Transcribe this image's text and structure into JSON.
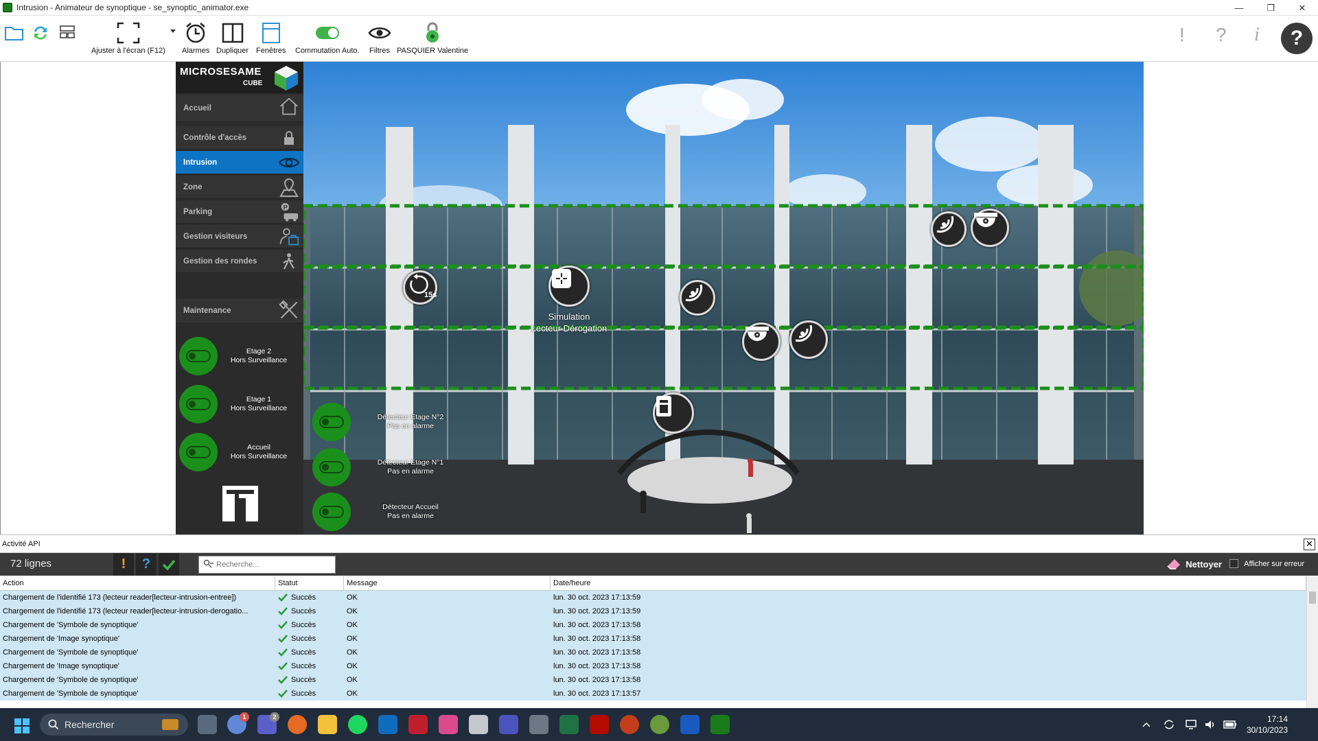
{
  "window": {
    "title": "Intrusion - Animateur de synoptique - se_synoptic_animator.exe",
    "controls": [
      "—",
      "❐",
      "✕"
    ]
  },
  "toolbar": {
    "fit_label": "Ajuster à l'écran (F12)",
    "alarms_label": "Alarmes",
    "duplicate_label": "Dupliquer",
    "windows_label": "Fenêtres",
    "auto_switch_label": "Commutation Auto.",
    "filters_label": "Filtres",
    "user_label": "PASQUIER Valentine",
    "right_icons": [
      "!",
      "?",
      "i"
    ]
  },
  "sidebar": {
    "logo_text": "MICROSESAME",
    "logo_sub": "CUBE",
    "items": [
      {
        "label": "Accueil"
      },
      {
        "label": "Contrôle d'accès"
      },
      {
        "label": "Intrusion"
      },
      {
        "label": "Zone"
      },
      {
        "label": "Parking"
      },
      {
        "label": "Gestion visiteurs"
      },
      {
        "label": "Gestion des rondes"
      },
      {
        "label": "Maintenance"
      }
    ],
    "floors": [
      {
        "name": "Etage 2",
        "state": "Hors Surveillance"
      },
      {
        "name": "Etage 1",
        "state": "Hors Surveillance"
      },
      {
        "name": "Accueil",
        "state": "Hors Surveillance"
      }
    ]
  },
  "scene": {
    "timer_label": "15s",
    "simulation_line1": "Simulation",
    "simulation_line2": "Lecteur Dérogation",
    "detectors": [
      {
        "name": "Détecteur Etage N°2",
        "state": "Pas en alarme"
      },
      {
        "name": "Détecteur Etage N°1",
        "state": "Pas en alarme"
      },
      {
        "name": "Détecteur Accueil",
        "state": "Pas en alarme"
      }
    ]
  },
  "api": {
    "title": "Activité API",
    "close": "✕",
    "count": "72 lignes",
    "filter_warning": "!",
    "filter_question": "?",
    "search_placeholder": "Recherche...",
    "clean_label": "Nettoyer",
    "show_error_label": "Afficher sur erreur",
    "columns": [
      "Action",
      "Statut",
      "Message",
      "Date/heure"
    ],
    "rows": [
      {
        "action": "Chargement de l'identifié 173 (lecteur reader[lecteur-intrusion-entree])",
        "status": "Succès",
        "message": "OK",
        "date": "lun. 30 oct. 2023 17:13:59"
      },
      {
        "action": "Chargement de l'identifié 173 (lecteur reader[lecteur-intrusion-derogatio...",
        "status": "Succès",
        "message": "OK",
        "date": "lun. 30 oct. 2023 17:13:59"
      },
      {
        "action": "Chargement de 'Symbole de synoptique'",
        "status": "Succès",
        "message": "OK",
        "date": "lun. 30 oct. 2023 17:13:58"
      },
      {
        "action": "Chargement de 'Image synoptique'",
        "status": "Succès",
        "message": "OK",
        "date": "lun. 30 oct. 2023 17:13:58"
      },
      {
        "action": "Chargement de 'Symbole de synoptique'",
        "status": "Succès",
        "message": "OK",
        "date": "lun. 30 oct. 2023 17:13:58"
      },
      {
        "action": "Chargement de 'Image synoptique'",
        "status": "Succès",
        "message": "OK",
        "date": "lun. 30 oct. 2023 17:13:58"
      },
      {
        "action": "Chargement de 'Symbole de synoptique'",
        "status": "Succès",
        "message": "OK",
        "date": "lun. 30 oct. 2023 17:13:58"
      },
      {
        "action": "Chargement de 'Symbole de synoptique'",
        "status": "Succès",
        "message": "OK",
        "date": "lun. 30 oct. 2023 17:13:57"
      }
    ]
  },
  "taskbar": {
    "search_label": "Rechercher",
    "time": "17:14",
    "date": "30/10/2023",
    "badge_1": "1",
    "badge_2": "2"
  },
  "colors": {
    "accent_blue": "#0e73c2",
    "ok_green": "#1b8f1b",
    "sidebar_bg": "#2b2b2b",
    "row_bg": "#cfe6f4",
    "zone_dash": "#1a8f1a"
  }
}
